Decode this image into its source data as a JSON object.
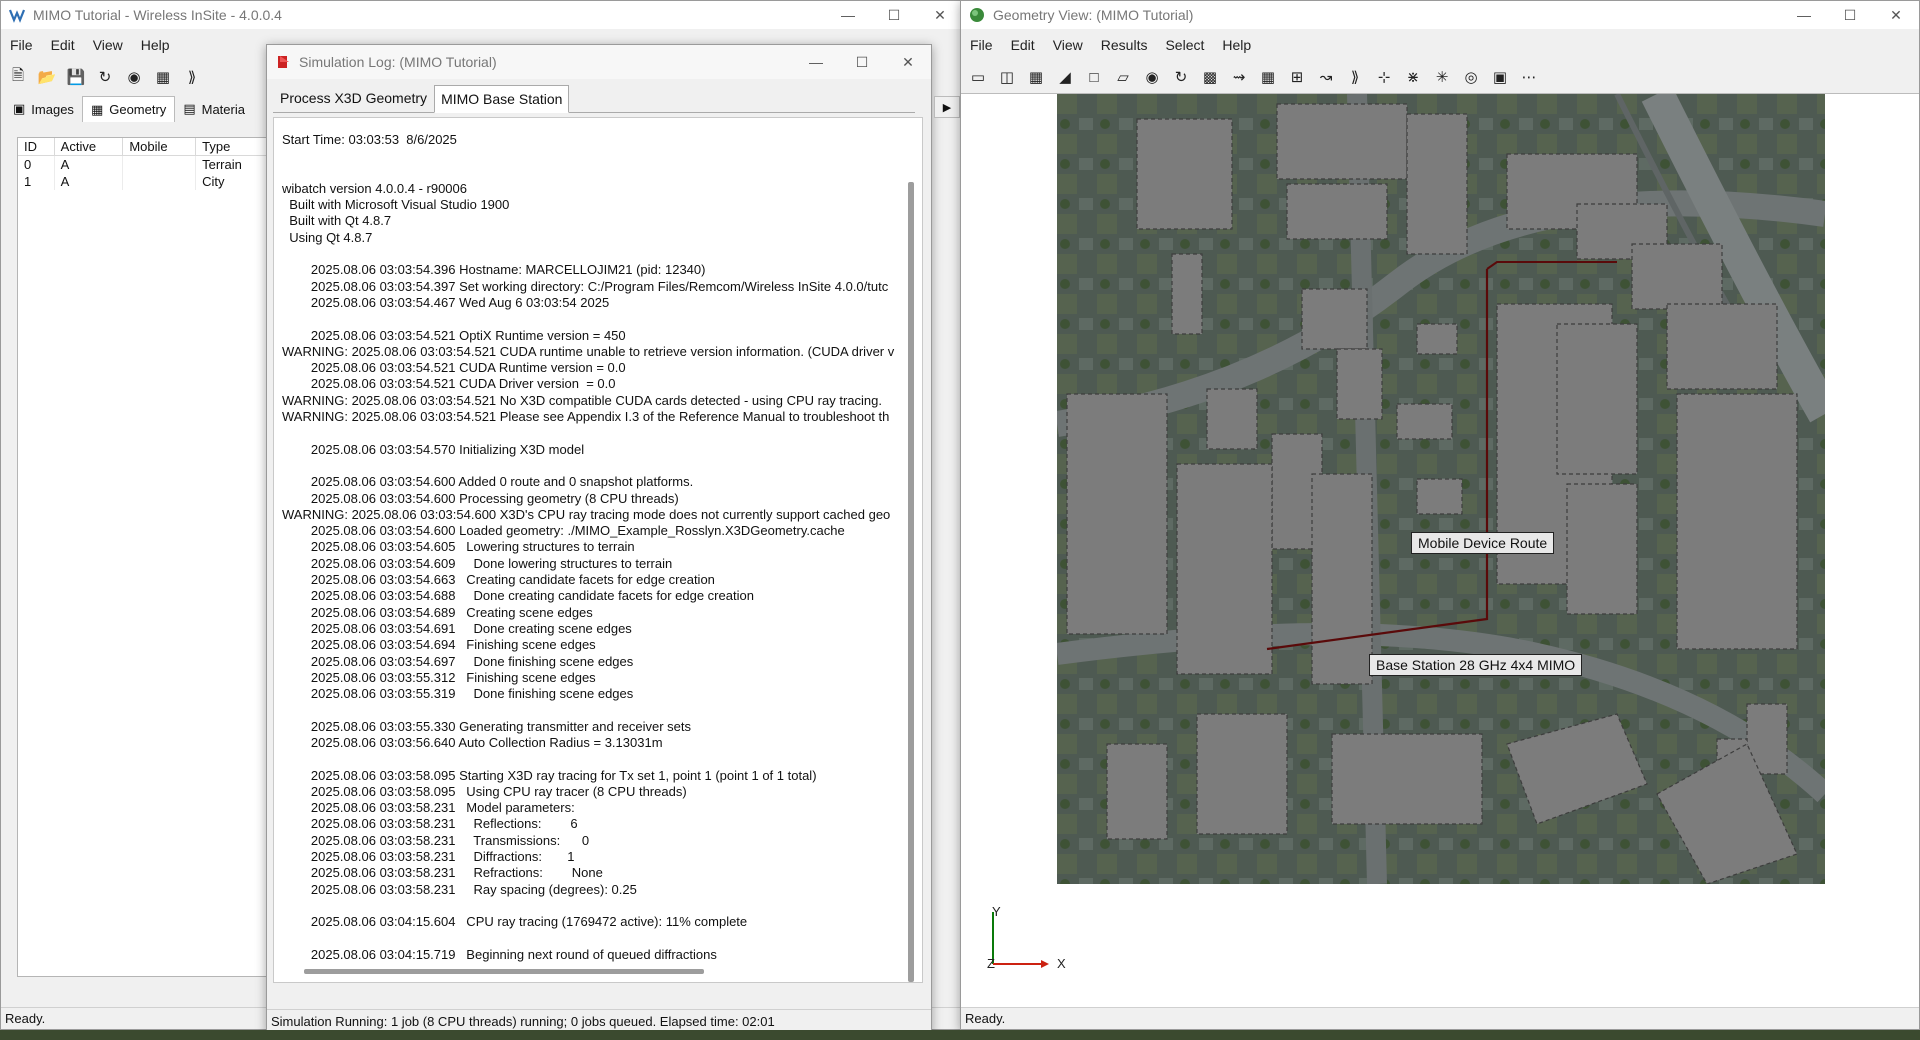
{
  "main": {
    "title": "MIMO Tutorial - Wireless InSite - 4.0.0.4",
    "menu": [
      "File",
      "Edit",
      "View",
      "Help"
    ],
    "tabs": [
      "Images",
      "Geometry",
      "Materia"
    ],
    "table": {
      "columns": [
        "ID",
        "Active",
        "Mobile",
        "Type"
      ],
      "rows": [
        [
          "0",
          "A",
          "",
          "Terrain"
        ],
        [
          "1",
          "A",
          "",
          "City"
        ]
      ]
    },
    "status": "Ready."
  },
  "log": {
    "title": "Simulation Log: (MIMO Tutorial)",
    "tabs": [
      "Process X3D Geometry",
      "MIMO Base Station"
    ],
    "text": "Start Time: 03:03:53  8/6/2025\n\n\nwibatch version 4.0.0.4 - r90006\n  Built with Microsoft Visual Studio 1900\n  Built with Qt 4.8.7\n  Using Qt 4.8.7\n\n        2025.08.06 03:03:54.396 Hostname: MARCELLOJIM21 (pid: 12340)\n        2025.08.06 03:03:54.397 Set working directory: C:/Program Files/Remcom/Wireless InSite 4.0.0/tutc\n        2025.08.06 03:03:54.467 Wed Aug 6 03:03:54 2025\n\n        2025.08.06 03:03:54.521 OptiX Runtime version = 450\nWARNING: 2025.08.06 03:03:54.521 CUDA runtime unable to retrieve version information. (CUDA driver v\n        2025.08.06 03:03:54.521 CUDA Runtime version = 0.0\n        2025.08.06 03:03:54.521 CUDA Driver version  = 0.0\nWARNING: 2025.08.06 03:03:54.521 No X3D compatible CUDA cards detected - using CPU ray tracing.\nWARNING: 2025.08.06 03:03:54.521 Please see Appendix I.3 of the Reference Manual to troubleshoot th\n\n        2025.08.06 03:03:54.570 Initializing X3D model\n\n        2025.08.06 03:03:54.600 Added 0 route and 0 snapshot platforms.\n        2025.08.06 03:03:54.600 Processing geometry (8 CPU threads)\nWARNING: 2025.08.06 03:03:54.600 X3D's CPU ray tracing mode does not currently support cached geo\n        2025.08.06 03:03:54.600 Loaded geometry: ./MIMO_Example_Rosslyn.X3DGeometry.cache\n        2025.08.06 03:03:54.605   Lowering structures to terrain\n        2025.08.06 03:03:54.609     Done lowering structures to terrain\n        2025.08.06 03:03:54.663   Creating candidate facets for edge creation\n        2025.08.06 03:03:54.688     Done creating candidate facets for edge creation\n        2025.08.06 03:03:54.689   Creating scene edges\n        2025.08.06 03:03:54.691     Done creating scene edges\n        2025.08.06 03:03:54.694   Finishing scene edges\n        2025.08.06 03:03:54.697     Done finishing scene edges\n        2025.08.06 03:03:55.312   Finishing scene edges\n        2025.08.06 03:03:55.319     Done finishing scene edges\n\n        2025.08.06 03:03:55.330 Generating transmitter and receiver sets\n        2025.08.06 03:03:56.640 Auto Collection Radius = 3.13031m\n\n        2025.08.06 03:03:58.095 Starting X3D ray tracing for Tx set 1, point 1 (point 1 of 1 total)\n        2025.08.06 03:03:58.095   Using CPU ray tracer (8 CPU threads)\n        2025.08.06 03:03:58.231   Model parameters:\n        2025.08.06 03:03:58.231     Reflections:        6\n        2025.08.06 03:03:58.231     Transmissions:      0\n        2025.08.06 03:03:58.231     Diffractions:       1\n        2025.08.06 03:03:58.231     Refractions:        None\n        2025.08.06 03:03:58.231     Ray spacing (degrees): 0.25\n\n        2025.08.06 03:04:15.604   CPU ray tracing (1769472 active): 11% complete\n\n        2025.08.06 03:04:15.719   Beginning next round of queued diffractions",
    "status": "Simulation Running: 1 job (8 CPU threads) running; 0 jobs queued.  Elapsed time: 02:01"
  },
  "geo": {
    "title": "Geometry View: (MIMO Tutorial)",
    "menu": [
      "File",
      "Edit",
      "View",
      "Results",
      "Select",
      "Help"
    ],
    "labels": {
      "route": "Mobile Device Route",
      "base_station": "Base Station 28 GHz 4x4 MIMO"
    },
    "axes": {
      "x": "X",
      "y": "Y",
      "z": "Z"
    },
    "status": "Ready."
  },
  "icons": {
    "minimize": "minimize-icon",
    "maximize": "maximize-icon",
    "close": "close-icon"
  },
  "colors": {
    "route_line": "#5a0a0a",
    "building": "#7a7a7a",
    "title_text": "#777777"
  }
}
